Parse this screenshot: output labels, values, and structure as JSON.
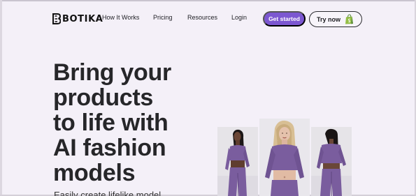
{
  "header": {
    "brand": "BOTIKA",
    "nav": {
      "how_it_works": "How It Works",
      "pricing": "Pricing",
      "resources": "Resources",
      "login": "Login"
    },
    "get_started_label": "Get started",
    "try_now_label": "Try now"
  },
  "hero": {
    "title_lines": [
      "Bring your",
      "products",
      "to life with",
      "AI fashion",
      "models"
    ],
    "subtitle": "Easily create lifelike model"
  },
  "colors": {
    "background": "#f4f0f8",
    "accent": "#7c57d1",
    "outfit": "#7a5d9e"
  },
  "icons": [
    "botika-logo-icon",
    "shopify-bag-icon"
  ]
}
